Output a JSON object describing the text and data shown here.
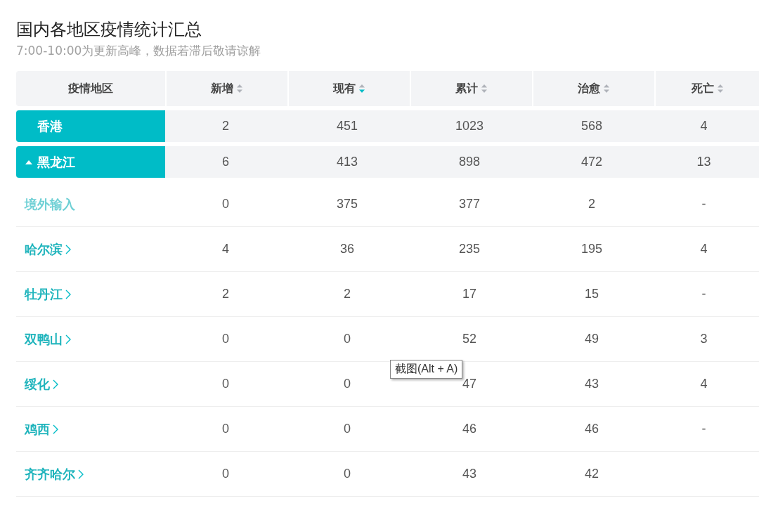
{
  "title": "国内各地区疫情统计汇总",
  "subtitle": "7:00-10:00为更新高峰，数据若滞后敬请谅解",
  "columns": [
    {
      "label": "疫情地区",
      "sortable": false
    },
    {
      "label": "新增",
      "sortable": true,
      "sorted": false
    },
    {
      "label": "现有",
      "sortable": true,
      "sorted": true
    },
    {
      "label": "累计",
      "sortable": true,
      "sorted": false
    },
    {
      "label": "治愈",
      "sortable": true,
      "sorted": false
    },
    {
      "label": "死亡",
      "sortable": true,
      "sorted": false
    }
  ],
  "rows": [
    {
      "kind": "province",
      "region": "香港",
      "values": [
        "2",
        "451",
        "1023",
        "568",
        "4"
      ]
    },
    {
      "kind": "province",
      "region": "黑龙江",
      "expanded": true,
      "values": [
        "6",
        "413",
        "898",
        "472",
        "13"
      ]
    },
    {
      "kind": "import",
      "region": "境外输入",
      "values": [
        "0",
        "375",
        "377",
        "2",
        "-"
      ]
    },
    {
      "kind": "city",
      "region": "哈尔滨",
      "values": [
        "4",
        "36",
        "235",
        "195",
        "4"
      ]
    },
    {
      "kind": "city",
      "region": "牡丹江",
      "values": [
        "2",
        "2",
        "17",
        "15",
        "-"
      ]
    },
    {
      "kind": "city",
      "region": "双鸭山",
      "values": [
        "0",
        "0",
        "52",
        "49",
        "3"
      ]
    },
    {
      "kind": "city",
      "region": "绥化",
      "values": [
        "0",
        "0",
        "47",
        "43",
        "4"
      ]
    },
    {
      "kind": "city",
      "region": "鸡西",
      "values": [
        "0",
        "0",
        "46",
        "46",
        "-"
      ]
    },
    {
      "kind": "city",
      "region": "齐齐哈尔",
      "values": [
        "0",
        "0",
        "43",
        "42"
      ]
    }
  ],
  "tooltip": "截图(Alt + A)"
}
